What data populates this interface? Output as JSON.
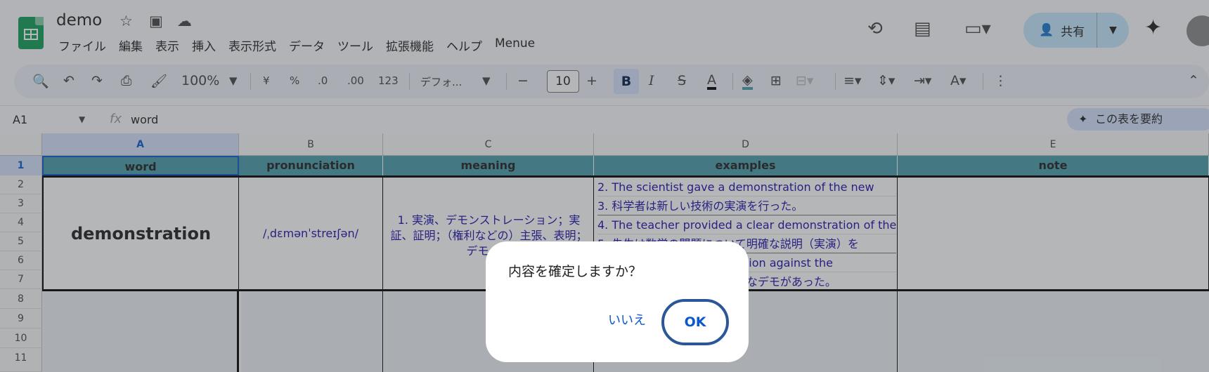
{
  "doc": {
    "title": "demo"
  },
  "menu": [
    "ファイル",
    "編集",
    "表示",
    "挿入",
    "表示形式",
    "データ",
    "ツール",
    "拡張機能",
    "ヘルプ",
    "Menue"
  ],
  "share": {
    "label": "共有"
  },
  "toolbar": {
    "zoom": "100%",
    "currency": "¥",
    "percent": "%",
    "dec_dec": ".0",
    "dec_inc": ".00",
    "number_format": "123",
    "font": "デフォ...",
    "font_size": "10",
    "bold": "B",
    "italic": "I",
    "text_color": "A"
  },
  "formula": {
    "cell_ref": "A1",
    "value": "word",
    "summarize": "この表を要約"
  },
  "columns": [
    "A",
    "B",
    "C",
    "D",
    "E"
  ],
  "rows": [
    "1",
    "2",
    "3",
    "4",
    "5",
    "6",
    "7",
    "8",
    "9",
    "10",
    "11"
  ],
  "headers": {
    "a": "word",
    "b": "pronunciation",
    "c": "meaning",
    "d": "examples",
    "e": "note"
  },
  "entry": {
    "word": "demonstration",
    "pronunciation": "/ˌdɛmənˈstreɪʃən/",
    "meaning": "1. 実演、デモンストレーション；実証、証明；（権利などの）主張、表明；デモ、示",
    "examples": [
      "2. The scientist gave a demonstration of the new",
      "3. 科学者は新しい技術の実演を行った。",
      "4.  The teacher provided a clear demonstration of the",
      "5. 先生は数学の問題について明確な説明（実演）を",
      "6. There was a demonstration against the",
      "7. 新しい法律に対して大規模なデモがあった。"
    ]
  },
  "dialog": {
    "message": "内容を確定しますか？",
    "no": "いいえ",
    "ok": "OK"
  }
}
